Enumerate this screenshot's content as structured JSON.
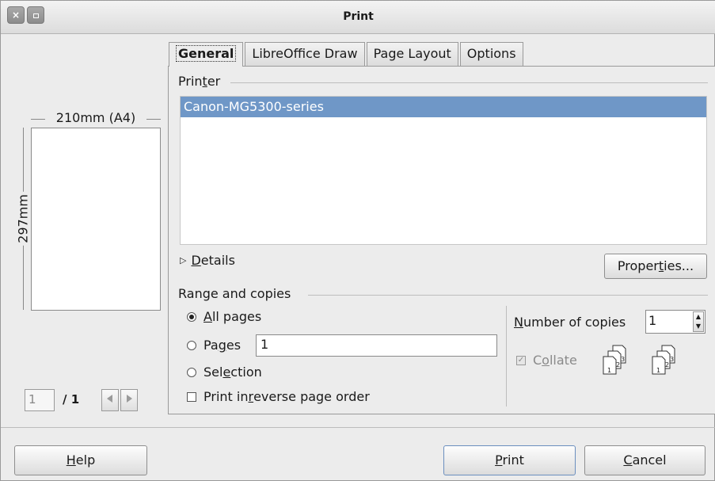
{
  "window": {
    "title": "Print",
    "close_glyph": "×"
  },
  "preview": {
    "width_label": "210mm (A4)",
    "height_label": "297mm",
    "page_number": "1",
    "page_total": "/ 1"
  },
  "tabs": [
    {
      "label": "General",
      "active": true
    },
    {
      "label": "LibreOffice Draw",
      "active": false
    },
    {
      "label": "Page Layout",
      "active": false
    },
    {
      "label": "Options",
      "active": false
    }
  ],
  "printer": {
    "section_label_pre": "Prin",
    "section_label_u": "t",
    "section_label_post": "er",
    "selected": "Canon-MG5300-series",
    "details_label": "Details",
    "properties_pre": "Proper",
    "properties_u": "t",
    "properties_post": "ies..."
  },
  "range": {
    "section_label": "Range and copies",
    "all_pages": {
      "u": "A",
      "rest": "ll pages",
      "checked": true
    },
    "pages": {
      "pre": "Pa",
      "u": "g",
      "post": "es",
      "value": "1"
    },
    "selection": {
      "pre": "Sel",
      "u": "e",
      "post": "ction"
    },
    "reverse": {
      "pre": "Print in ",
      "u": "r",
      "post": "everse page order"
    }
  },
  "copies": {
    "label_u": "N",
    "label_rest": "umber of copies",
    "value": "1",
    "collate_pre": "C",
    "collate_u": "o",
    "collate_post": "llate",
    "collate_checked": true,
    "collate_enabled": false
  },
  "buttons": {
    "help_u": "H",
    "help_rest": "elp",
    "print_u": "P",
    "print_rest": "rint",
    "cancel_u": "C",
    "cancel_rest": "ancel"
  },
  "colors": {
    "selection": "#6f97c7",
    "window_bg": "#ececec"
  }
}
